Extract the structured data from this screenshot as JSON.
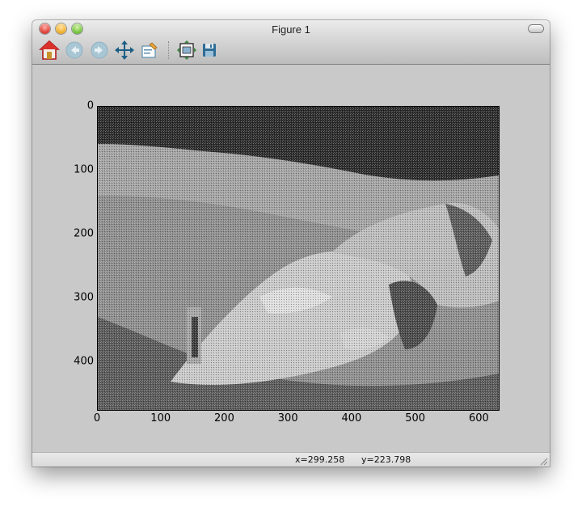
{
  "window": {
    "title": "Figure 1"
  },
  "toolbar": {
    "buttons": [
      {
        "name": "home-button",
        "icon": "home-icon"
      },
      {
        "name": "back-button",
        "icon": "arrow-left-icon"
      },
      {
        "name": "forward-button",
        "icon": "arrow-right-icon"
      },
      {
        "name": "pan-button",
        "icon": "move-arrows-icon"
      },
      {
        "name": "zoom-button",
        "icon": "zoom-rect-icon"
      },
      {
        "name": "subplots-button",
        "icon": "subplots-icon"
      },
      {
        "name": "save-button",
        "icon": "floppy-disk-icon"
      }
    ]
  },
  "status": {
    "x_readout": "x=299.258",
    "y_readout": "y=223.798"
  },
  "chart_data": {
    "type": "image",
    "title": "",
    "xlabel": "",
    "ylabel": "",
    "xlim": [
      0,
      630
    ],
    "ylim": [
      475,
      0
    ],
    "x_ticks": [
      "0",
      "100",
      "200",
      "300",
      "400",
      "500",
      "600"
    ],
    "y_ticks": [
      "0",
      "100",
      "200",
      "300",
      "400"
    ],
    "x_tick_values": [
      0,
      100,
      200,
      300,
      400,
      500,
      600
    ],
    "y_tick_values": [
      0,
      100,
      200,
      300,
      400
    ],
    "colors": {
      "dark": "#2b2b2b",
      "mid": "#7a7a7a",
      "light": "#d8d8d8"
    }
  }
}
